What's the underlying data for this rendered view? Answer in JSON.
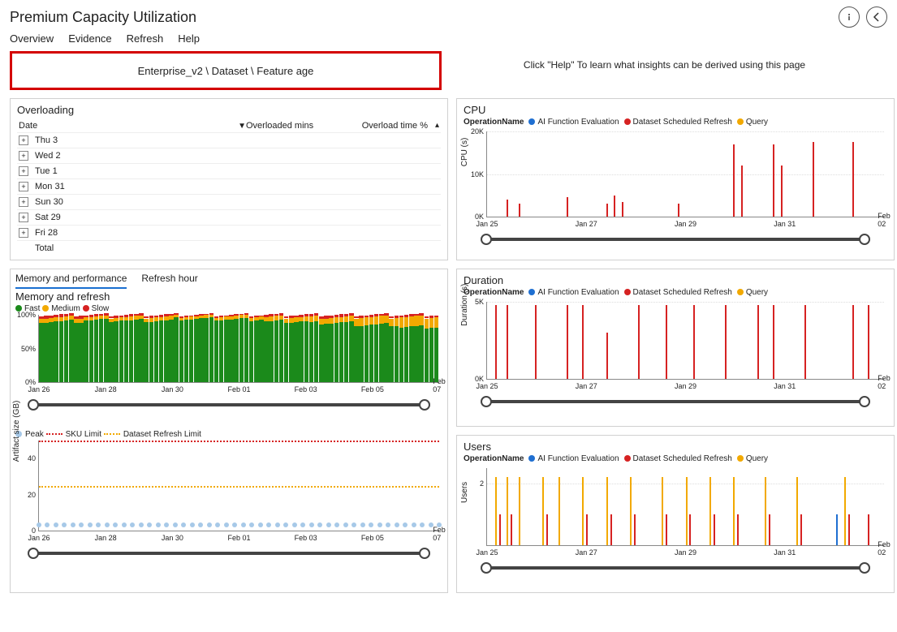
{
  "header": {
    "title": "Premium Capacity Utilization",
    "info_tooltip": "Info",
    "back_tooltip": "Back"
  },
  "menu": [
    "Overview",
    "Evidence",
    "Refresh",
    "Help"
  ],
  "breadcrumb": "Enterprise_v2 \\ Dataset \\ Feature age",
  "help_hint": "Click \"Help\" To learn what insights can be derived using this page",
  "overloading": {
    "title": "Overloading",
    "columns": {
      "date": "Date",
      "mins": "Overloaded mins",
      "pct": "Overload time %"
    },
    "rows": [
      {
        "label": "Thu 3",
        "expandable": true
      },
      {
        "label": "Wed 2",
        "expandable": true
      },
      {
        "label": "Tue 1",
        "expandable": true
      },
      {
        "label": "Mon 31",
        "expandable": true
      },
      {
        "label": "Sun 30",
        "expandable": true
      },
      {
        "label": "Sat 29",
        "expandable": true
      },
      {
        "label": "Fri 28",
        "expandable": true
      },
      {
        "label": "Total",
        "expandable": false
      }
    ]
  },
  "operation_legend": {
    "label": "OperationName",
    "items": [
      {
        "name": "AI Function Evaluation",
        "color": "#1f6fd1"
      },
      {
        "name": "Dataset Scheduled Refresh",
        "color": "#d62222"
      },
      {
        "name": "Query",
        "color": "#f2a900"
      }
    ]
  },
  "memory_tabs": {
    "items": [
      "Memory and performance",
      "Refresh hour"
    ],
    "active": 0,
    "subtitle": "Memory and refresh",
    "legend": [
      {
        "name": "Fast",
        "color": "#1b8a1b"
      },
      {
        "name": "Medium",
        "color": "#f2a900"
      },
      {
        "name": "Slow",
        "color": "#d62222"
      }
    ]
  },
  "artifact_legend": [
    {
      "name": "Peak",
      "type": "dot",
      "color": "#a7c9e8"
    },
    {
      "name": "SKU Limit",
      "type": "dash",
      "color": "#d62222"
    },
    {
      "name": "Dataset Refresh Limit",
      "type": "dash",
      "color": "#f2a900"
    }
  ],
  "chart_data": [
    {
      "id": "cpu",
      "title": "CPU",
      "type": "bar",
      "ylabel": "CPU (s)",
      "ylim": [
        0,
        20000
      ],
      "yticks": [
        {
          "v": 0,
          "l": "0K"
        },
        {
          "v": 10000,
          "l": "10K"
        },
        {
          "v": 20000,
          "l": "20K"
        }
      ],
      "x_range": [
        "Jan 25",
        "Feb 03"
      ],
      "xticks": [
        "Jan 25",
        "Jan 27",
        "Jan 29",
        "Jan 31",
        "Feb 02"
      ],
      "series": [
        {
          "name": "Dataset Scheduled Refresh",
          "color": "#d62222",
          "points": [
            {
              "x": 0.05,
              "y": 4000
            },
            {
              "x": 0.08,
              "y": 3000
            },
            {
              "x": 0.2,
              "y": 4500
            },
            {
              "x": 0.3,
              "y": 3000
            },
            {
              "x": 0.32,
              "y": 5000
            },
            {
              "x": 0.34,
              "y": 3500
            },
            {
              "x": 0.48,
              "y": 3000
            },
            {
              "x": 0.62,
              "y": 17000
            },
            {
              "x": 0.64,
              "y": 12000
            },
            {
              "x": 0.72,
              "y": 17000
            },
            {
              "x": 0.74,
              "y": 12000
            },
            {
              "x": 0.82,
              "y": 17500
            },
            {
              "x": 0.92,
              "y": 17500
            }
          ]
        }
      ]
    },
    {
      "id": "duration",
      "title": "Duration",
      "type": "bar",
      "ylabel": "Duration (s)",
      "ylim": [
        0,
        5000
      ],
      "yticks": [
        {
          "v": 0,
          "l": "0K"
        },
        {
          "v": 5000,
          "l": "5K"
        }
      ],
      "x_range": [
        "Jan 25",
        "Feb 03"
      ],
      "xticks": [
        "Jan 25",
        "Jan 27",
        "Jan 29",
        "Jan 31",
        "Feb 02"
      ],
      "series": [
        {
          "name": "Dataset Scheduled Refresh",
          "color": "#d62222",
          "points": [
            {
              "x": 0.02,
              "y": 4800
            },
            {
              "x": 0.05,
              "y": 4800
            },
            {
              "x": 0.12,
              "y": 4800
            },
            {
              "x": 0.2,
              "y": 4800
            },
            {
              "x": 0.24,
              "y": 4800
            },
            {
              "x": 0.3,
              "y": 3000
            },
            {
              "x": 0.38,
              "y": 4800
            },
            {
              "x": 0.45,
              "y": 4800
            },
            {
              "x": 0.52,
              "y": 4800
            },
            {
              "x": 0.6,
              "y": 4800
            },
            {
              "x": 0.68,
              "y": 4800
            },
            {
              "x": 0.72,
              "y": 4800
            },
            {
              "x": 0.8,
              "y": 4800
            },
            {
              "x": 0.92,
              "y": 4800
            },
            {
              "x": 0.96,
              "y": 4800
            }
          ]
        }
      ]
    },
    {
      "id": "users",
      "title": "Users",
      "type": "bar",
      "ylabel": "Users",
      "ylim": [
        0,
        2.5
      ],
      "yticks": [
        {
          "v": 2,
          "l": "2"
        }
      ],
      "x_range": [
        "Jan 25",
        "Feb 03"
      ],
      "xticks": [
        "Jan 25",
        "Jan 27",
        "Jan 29",
        "Jan 31",
        "Feb 02"
      ],
      "series": [
        {
          "name": "Query",
          "color": "#f2a900",
          "points": [
            {
              "x": 0.02,
              "y": 2.2
            },
            {
              "x": 0.05,
              "y": 2.2
            },
            {
              "x": 0.08,
              "y": 2.2
            },
            {
              "x": 0.14,
              "y": 2.2
            },
            {
              "x": 0.18,
              "y": 2.2
            },
            {
              "x": 0.24,
              "y": 2.2
            },
            {
              "x": 0.3,
              "y": 2.2
            },
            {
              "x": 0.36,
              "y": 2.2
            },
            {
              "x": 0.44,
              "y": 2.2
            },
            {
              "x": 0.5,
              "y": 2.2
            },
            {
              "x": 0.56,
              "y": 2.2
            },
            {
              "x": 0.62,
              "y": 2.2
            },
            {
              "x": 0.7,
              "y": 2.2
            },
            {
              "x": 0.78,
              "y": 2.2
            },
            {
              "x": 0.9,
              "y": 2.2
            }
          ]
        },
        {
          "name": "Dataset Scheduled Refresh",
          "color": "#d62222",
          "points": [
            {
              "x": 0.03,
              "y": 1
            },
            {
              "x": 0.06,
              "y": 1
            },
            {
              "x": 0.15,
              "y": 1
            },
            {
              "x": 0.25,
              "y": 1
            },
            {
              "x": 0.31,
              "y": 1
            },
            {
              "x": 0.37,
              "y": 1
            },
            {
              "x": 0.45,
              "y": 1
            },
            {
              "x": 0.51,
              "y": 1
            },
            {
              "x": 0.57,
              "y": 1
            },
            {
              "x": 0.63,
              "y": 1
            },
            {
              "x": 0.71,
              "y": 1
            },
            {
              "x": 0.79,
              "y": 1
            },
            {
              "x": 0.91,
              "y": 1
            },
            {
              "x": 0.96,
              "y": 1
            }
          ]
        },
        {
          "name": "AI Function Evaluation",
          "color": "#1f6fd1",
          "points": [
            {
              "x": 0.88,
              "y": 1
            }
          ]
        }
      ]
    },
    {
      "id": "memory_refresh",
      "type": "area-stacked",
      "ylabel": "",
      "ylim": [
        0,
        100
      ],
      "yticks": [
        {
          "v": 0,
          "l": "0%"
        },
        {
          "v": 50,
          "l": "50%"
        },
        {
          "v": 100,
          "l": "100%"
        }
      ],
      "xticks": [
        "Jan 26",
        "Jan 28",
        "Jan 30",
        "Feb 01",
        "Feb 03",
        "Feb 05",
        "Feb 07"
      ],
      "n_bars": 80,
      "stacks": {
        "fast_color": "#1b8a1b",
        "med_color": "#f2a900",
        "slow_color": "#d62222"
      },
      "pattern": [
        {
          "fast": 90,
          "med": 6,
          "slow": 4
        },
        {
          "fast": 92,
          "med": 5,
          "slow": 3
        },
        {
          "fast": 91,
          "med": 6,
          "slow": 3
        },
        {
          "fast": 94,
          "med": 4,
          "slow": 2
        },
        {
          "fast": 93,
          "med": 5,
          "slow": 2
        },
        {
          "fast": 90,
          "med": 7,
          "slow": 3
        },
        {
          "fast": 88,
          "med": 8,
          "slow": 4
        },
        {
          "fast": 85,
          "med": 12,
          "slow": 3
        },
        {
          "fast": 82,
          "med": 15,
          "slow": 3
        }
      ]
    },
    {
      "id": "artifact_size",
      "type": "scatter",
      "ylabel": "Artifact size (GB)",
      "ylim": [
        0,
        50
      ],
      "yticks": [
        {
          "v": 0,
          "l": "0"
        },
        {
          "v": 20,
          "l": "20"
        },
        {
          "v": 40,
          "l": "40"
        }
      ],
      "xticks": [
        "Jan 26",
        "Jan 28",
        "Jan 30",
        "Feb 01",
        "Feb 03",
        "Feb 05",
        "Feb 07"
      ],
      "reference_lines": [
        {
          "name": "SKU Limit",
          "y": 50,
          "color": "#d62222"
        },
        {
          "name": "Dataset Refresh Limit",
          "y": 25,
          "color": "#f2a900"
        }
      ],
      "peak_y": 3,
      "n_points": 48,
      "peak_color": "#a7c9e8"
    }
  ]
}
